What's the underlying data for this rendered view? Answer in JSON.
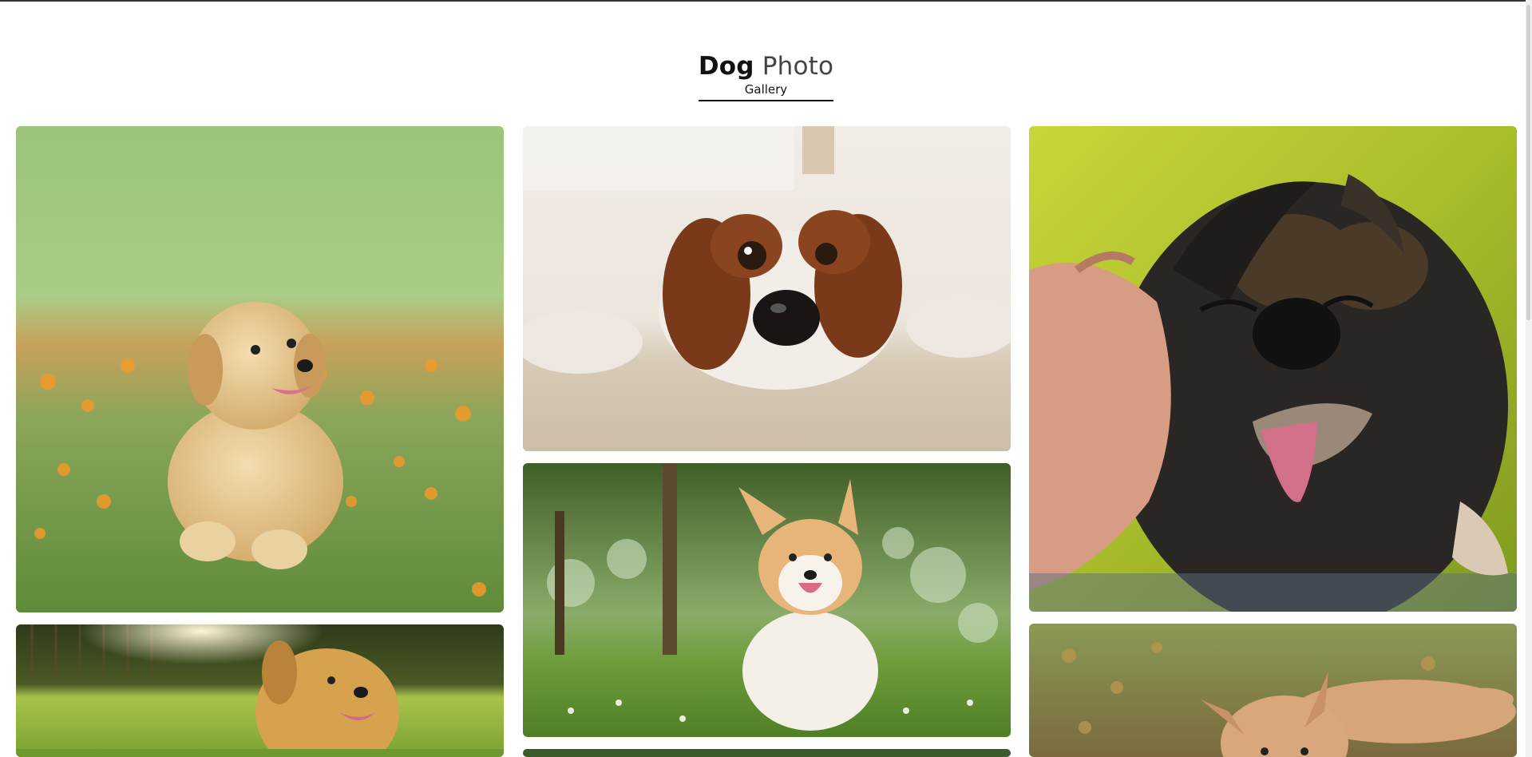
{
  "header": {
    "title_strong": "Dog",
    "title_light": "Photo",
    "subtitle": "Gallery"
  },
  "gallery": {
    "photos": [
      {
        "name": "golden-retriever-puppy-photo",
        "subject": "golden retriever puppy sitting in grass with orange petals"
      },
      {
        "name": "spaniel-lying-down-photo",
        "subject": "brown and white spaniel lying on carpet"
      },
      {
        "name": "black-tan-dog-smiling-photo",
        "subject": "black and tan dog being petted, tongue out"
      },
      {
        "name": "golden-retriever-sunlit-photo",
        "subject": "golden retriever lying on sunlit lawn"
      },
      {
        "name": "corgi-in-grass-photo",
        "subject": "corgi sitting in grass with trees behind"
      },
      {
        "name": "tan-puppy-leaves-photo",
        "subject": "tan puppy lying among fallen leaves"
      },
      {
        "name": "partial-photo-bottom",
        "subject": "partially visible photo"
      }
    ]
  },
  "colors": {
    "accent_rule": "#111111",
    "page_background": "#ffffff"
  }
}
